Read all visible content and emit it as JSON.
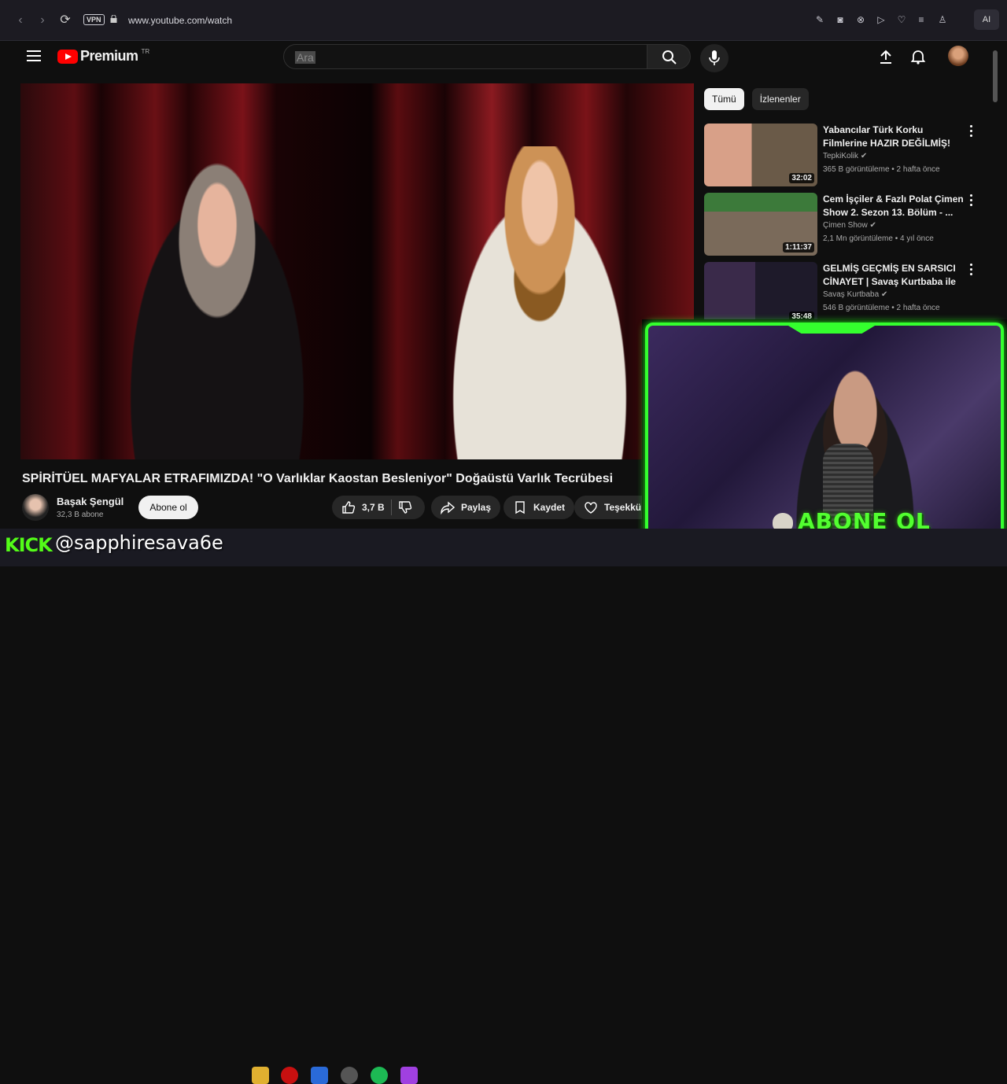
{
  "browser": {
    "vpn_label": "VPN",
    "url": "www.youtube.com/watch",
    "ai_label": "AI"
  },
  "youtube": {
    "logo_text": "Premium",
    "logo_badge": "TR",
    "search": {
      "placeholder": "Ara"
    },
    "video": {
      "title": "SPİRİTÜEL MAFYALAR ETRAFIMIZDA! \"O Varlıklar Kaostan Besleniyor\" Doğaüstü Varlık Tecrübesi",
      "channel": "Başak Şengül",
      "subscribers": "32,3 B abone",
      "subscribe_label": "Abone ol",
      "likes": "3,7 B",
      "share_label": "Paylaş",
      "save_label": "Kaydet",
      "thanks_label": "Teşekkü"
    },
    "chips": [
      {
        "label": "Tümü",
        "active": true
      },
      {
        "label": "İzlenenler",
        "active": false
      }
    ],
    "recommendations": [
      {
        "title": "Yabancılar Türk Korku Filmlerine HAZIR DEĞİLMİŞ!",
        "channel": "TepkiKolik",
        "meta": "365 B görüntüleme • 2 hafta önce",
        "duration": "32:02"
      },
      {
        "title": "Cem İşçiler & Fazlı Polat Çimen Show 2. Sezon 13. Bölüm - ...",
        "channel": "Çimen Show",
        "meta": "2,1 Mn görüntüleme • 4 yıl önce",
        "duration": "1:11:37"
      },
      {
        "title": "GELMİŞ GEÇMİŞ EN SARSICI CİNAYET | Savaş Kurtbaba ile ...",
        "channel": "Savaş Kurtbaba",
        "meta": "546 B görüntüleme • 2 hafta önce",
        "duration": "35:48"
      }
    ]
  },
  "overlay": {
    "cam_text": "ABONE OL",
    "kick_logo": "KICK",
    "kick_handle": "@sapphiresava6e"
  },
  "colors": {
    "accent_green": "#34ff2e",
    "youtube_red": "#ff0000",
    "kick_green": "#53fc18"
  }
}
